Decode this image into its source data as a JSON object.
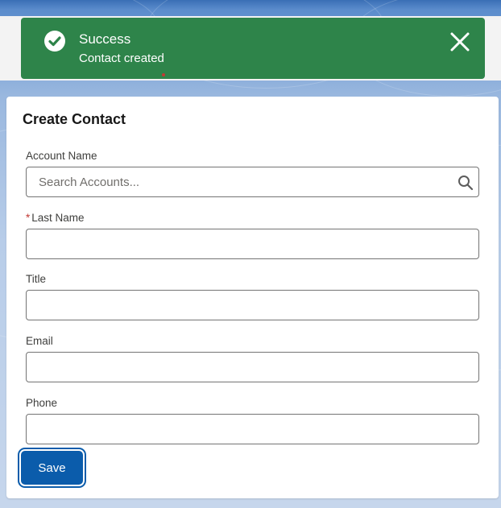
{
  "toast": {
    "title": "Success",
    "message": "Contact created",
    "background_color": "#2e844a",
    "icon": "check-circle-icon",
    "close_icon": "close-icon"
  },
  "form": {
    "title": "Create Contact",
    "account_name": {
      "label": "Account Name",
      "placeholder": "Search Accounts...",
      "value": "",
      "icon": "search-icon"
    },
    "last_name": {
      "required_mark": "*",
      "label": "Last Name",
      "value": ""
    },
    "title_field": {
      "label": "Title",
      "value": ""
    },
    "email": {
      "label": "Email",
      "value": ""
    },
    "phone": {
      "label": "Phone",
      "value": ""
    },
    "save_label": "Save",
    "save_color": "#0b5cab"
  }
}
